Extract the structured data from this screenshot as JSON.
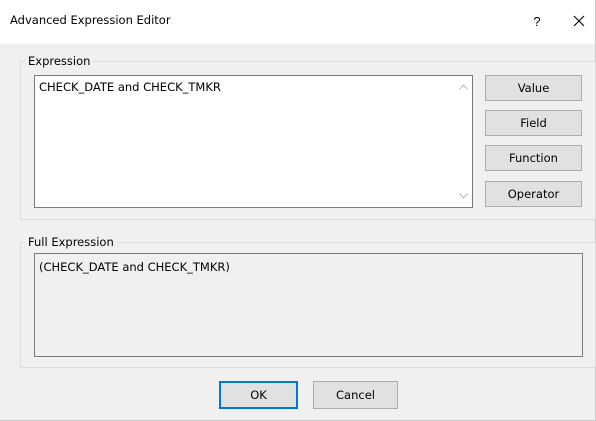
{
  "window": {
    "title": "Advanced Expression Editor",
    "help_glyph": "?",
    "close_icon": "close-icon"
  },
  "expression": {
    "legend": "Expression",
    "value": "CHECK_DATE and CHECK_TMKR"
  },
  "side_buttons": {
    "value": "Value",
    "field": "Field",
    "function": "Function",
    "operator": "Operator"
  },
  "full_expression": {
    "legend": "Full Expression",
    "value": "(CHECK_DATE and CHECK_TMKR)"
  },
  "footer": {
    "ok": "OK",
    "cancel": "Cancel"
  },
  "colors": {
    "default_button_border": "#0078d7",
    "dialog_background": "#f0f0f0"
  }
}
